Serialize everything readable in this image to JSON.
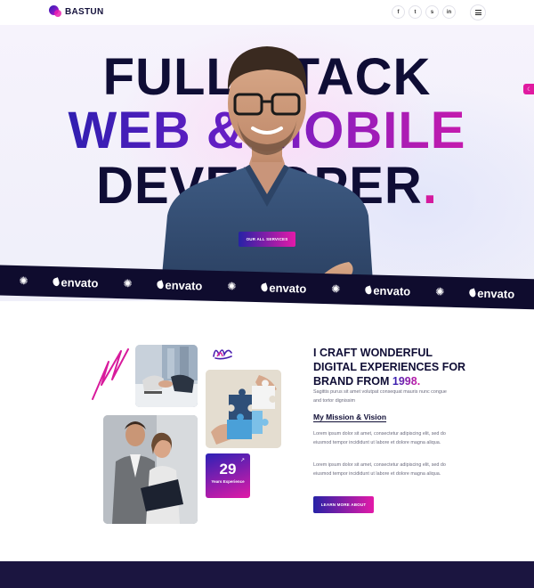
{
  "header": {
    "brand": "BASTUN",
    "socials": [
      {
        "icon": "facebook-icon",
        "glyph": "f"
      },
      {
        "icon": "twitter-icon",
        "glyph": "t"
      },
      {
        "icon": "skype-icon",
        "glyph": "s"
      },
      {
        "icon": "linkedin-icon",
        "glyph": "in"
      }
    ]
  },
  "hero": {
    "line1": "FULL STACK",
    "line2": "WEB & MOBILE",
    "line3": "DEVELOPER",
    "line3_dot": ".",
    "cta_label": "OUR ALL SERVICES"
  },
  "marquee": {
    "brand": "envato",
    "repeat": 5
  },
  "about": {
    "title_prefix": "I CRAFT WONDERFUL DIGITAL EXPERIENCES FOR BRAND FROM ",
    "year": "1998.",
    "subtitle": "Sagittis purus sit amet volutpat consequat mauris nunc congue and tortor dignissim",
    "mission_title": "My Mission & Vision",
    "paragraph1": "Lorem ipsum dolor sit amet, consectetur adipiscing elit, sed do eiusmod tempor incididunt ut labore et dolore magna aliqua.",
    "paragraph2": "Lorem ipsum dolor sit amet, consectetur adipiscing elit, sed do eiusmod tempor incididunt ut labore et dolore magna aliqua.",
    "cta_label": "LEARN MORE ABOUT",
    "experience": {
      "number": "29",
      "label": "Years Experience"
    }
  },
  "colors": {
    "primary_dark": "#0f0d35",
    "gradient_start": "#2722a6",
    "gradient_end": "#e31aa8",
    "marquee_bg": "#0f0c2e"
  }
}
